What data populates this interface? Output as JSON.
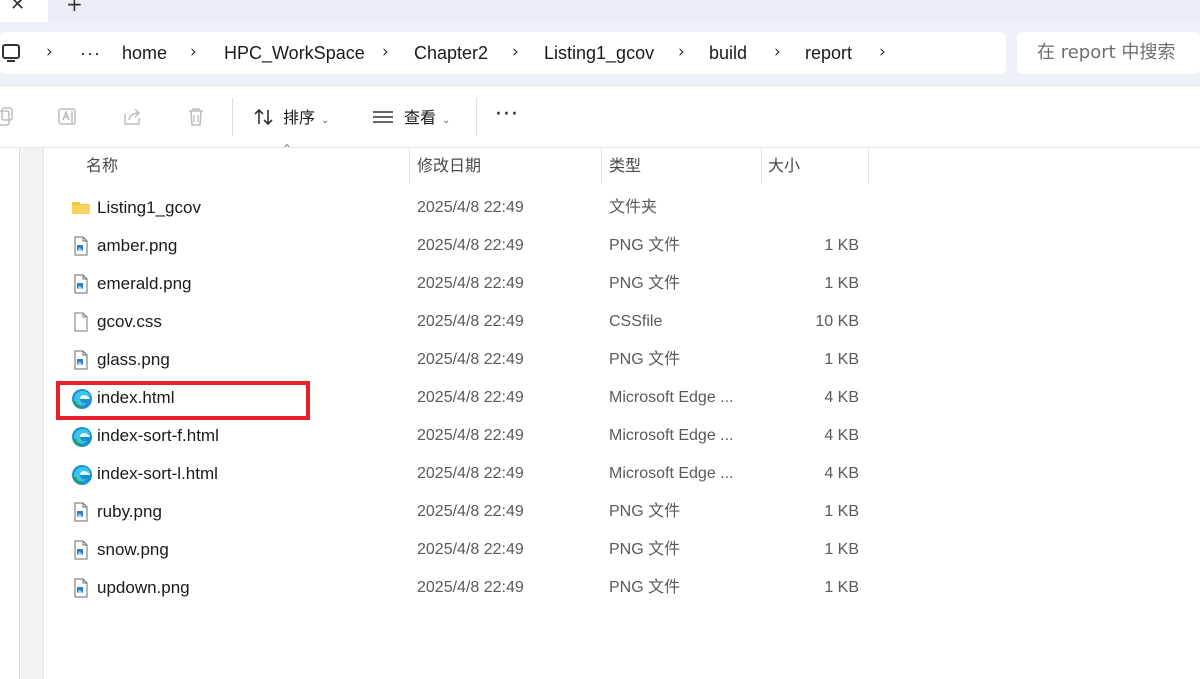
{
  "tabstrip": {
    "close_glyph": "✕",
    "newtab_glyph": "+"
  },
  "breadcrumb": {
    "items": [
      "home",
      "HPC_WorkSpace",
      "Chapter2",
      "Listing1_gcov",
      "build",
      "report"
    ],
    "overflow": "···"
  },
  "search": {
    "placeholder": "在 report 中搜索"
  },
  "toolbar": {
    "sort_label": "排序",
    "view_label": "查看",
    "more_label": "···"
  },
  "columns": {
    "name": "名称",
    "date": "修改日期",
    "type": "类型",
    "size": "大小"
  },
  "files": [
    {
      "name": "Listing1_gcov",
      "date": "2025/4/8 22:49",
      "type": "文件夹",
      "size": "",
      "icon": "folder-icon"
    },
    {
      "name": "amber.png",
      "date": "2025/4/8 22:49",
      "type": "PNG 文件",
      "size": "1 KB",
      "icon": "png-file-icon"
    },
    {
      "name": "emerald.png",
      "date": "2025/4/8 22:49",
      "type": "PNG 文件",
      "size": "1 KB",
      "icon": "png-file-icon"
    },
    {
      "name": "gcov.css",
      "date": "2025/4/8 22:49",
      "type": "CSSfile",
      "size": "10 KB",
      "icon": "blank-file-icon"
    },
    {
      "name": "glass.png",
      "date": "2025/4/8 22:49",
      "type": "PNG 文件",
      "size": "1 KB",
      "icon": "png-file-icon"
    },
    {
      "name": "index.html",
      "date": "2025/4/8 22:49",
      "type": "Microsoft Edge ...",
      "size": "4 KB",
      "icon": "edge-icon"
    },
    {
      "name": "index-sort-f.html",
      "date": "2025/4/8 22:49",
      "type": "Microsoft Edge ...",
      "size": "4 KB",
      "icon": "edge-icon"
    },
    {
      "name": "index-sort-l.html",
      "date": "2025/4/8 22:49",
      "type": "Microsoft Edge ...",
      "size": "4 KB",
      "icon": "edge-icon"
    },
    {
      "name": "ruby.png",
      "date": "2025/4/8 22:49",
      "type": "PNG 文件",
      "size": "1 KB",
      "icon": "png-file-icon"
    },
    {
      "name": "snow.png",
      "date": "2025/4/8 22:49",
      "type": "PNG 文件",
      "size": "1 KB",
      "icon": "png-file-icon"
    },
    {
      "name": "updown.png",
      "date": "2025/4/8 22:49",
      "type": "PNG 文件",
      "size": "1 KB",
      "icon": "png-file-icon"
    }
  ],
  "colors": {
    "highlight": "#e8202a",
    "folder": "#f6c443",
    "edge": "#1a8fd6"
  }
}
